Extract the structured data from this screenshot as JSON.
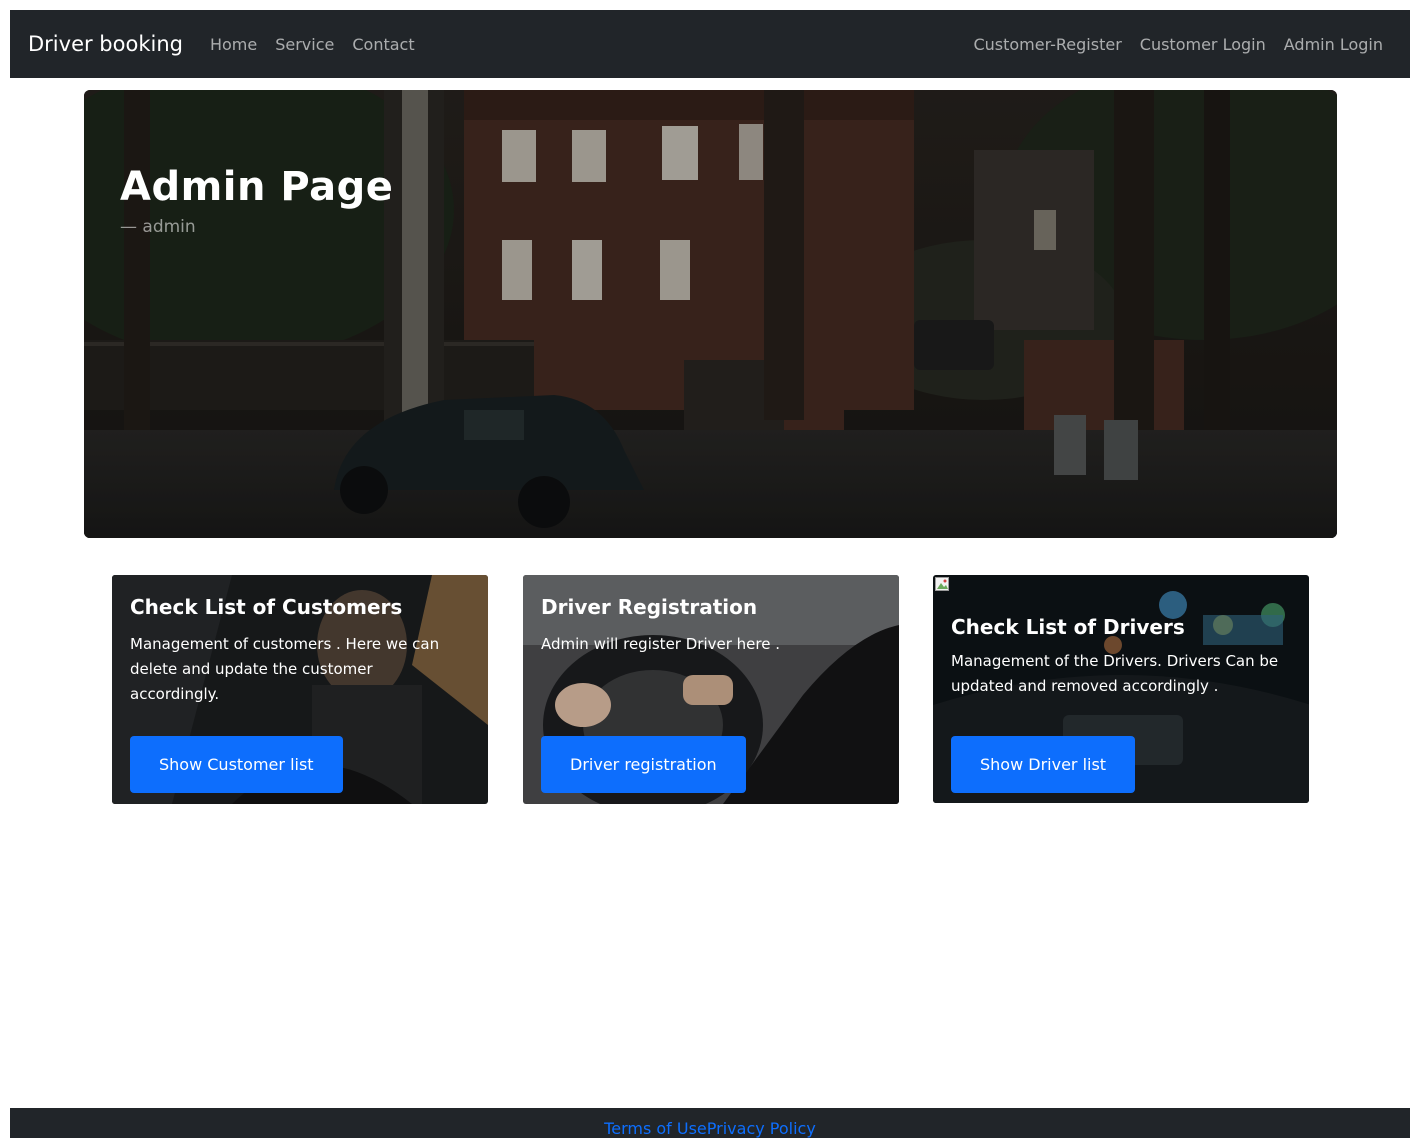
{
  "navbar": {
    "brand": "Driver booking",
    "left_links": [
      "Home",
      "Service",
      "Contact"
    ],
    "right_links": [
      "Customer-Register",
      "Customer Login",
      "Admin Login"
    ]
  },
  "hero": {
    "title": "Admin Page",
    "subtitle": "— admin"
  },
  "cards": [
    {
      "title": "Check List of Customers",
      "text": "Management of customers . Here we can delete and update the customer accordingly.",
      "button": "Show Customer list"
    },
    {
      "title": "Driver Registration",
      "text": "Admin will register Driver here .",
      "button": "Driver registration"
    },
    {
      "title": "Check List of Drivers",
      "text": "Management of the Drivers. Drivers Can be updated and removed accordingly .",
      "button": "Show Driver list"
    }
  ],
  "footer": {
    "links": [
      "Terms of Use",
      "Privacy Policy"
    ]
  },
  "colors": {
    "navbar_bg": "#212529",
    "primary": "#0d6efd",
    "white": "#ffffff"
  }
}
